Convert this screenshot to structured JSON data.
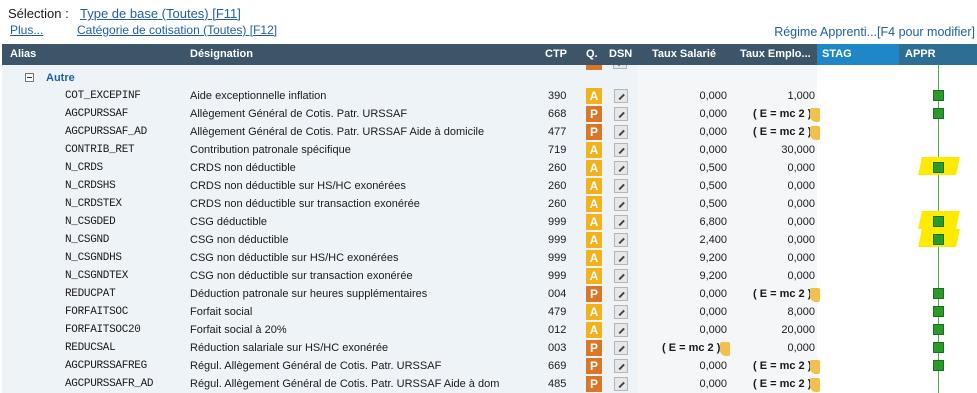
{
  "toolbar": {
    "selection_label": "Sélection :",
    "type_base_link": "Type de base (Toutes) [F11]",
    "plus_link": "Plus...",
    "categorie_link": "Catégorie de cotisation (Toutes) [F12]",
    "regime_text": "Régime Apprenti...[F4 pour modifier]"
  },
  "columns": {
    "alias": "Alias",
    "designation": "Désignation",
    "ctp": "CTP",
    "q": "Q.",
    "dsn": "DSN",
    "taux_salarie": "Taux Salarié",
    "taux_employeur": "Taux Emplo...",
    "stag": "STAG",
    "appr": "APPR"
  },
  "group": {
    "label": "Autre"
  },
  "rows": [
    {
      "alias": "COT_EXCEPINF",
      "designation": "Aide exceptionnelle inflation",
      "ctp": "390",
      "q": "A",
      "taux_salarie": "0,000",
      "taux_employeur": "1,000",
      "appr": true,
      "highlight": false
    },
    {
      "alias": "AGCPURSSAF",
      "designation": "Allègement Général de Cotis. Patr. URSSAF",
      "ctp": "668",
      "q": "P",
      "taux_salarie": "0,000",
      "taux_employeur": "( E = mc 2 )",
      "appr": true,
      "highlight": false
    },
    {
      "alias": "AGCPURSSAF_AD",
      "designation": "Allègement Général de Cotis. Patr. URSSAF Aide à domicile",
      "ctp": "477",
      "q": "P",
      "taux_salarie": "0,000",
      "taux_employeur": "( E = mc 2 )",
      "appr": false,
      "highlight": false
    },
    {
      "alias": "CONTRIB_RET",
      "designation": "Contribution patronale spécifique",
      "ctp": "719",
      "q": "A",
      "taux_salarie": "0,000",
      "taux_employeur": "30,000",
      "appr": false,
      "highlight": false
    },
    {
      "alias": "N_CRDS",
      "designation": "CRDS non déductible",
      "ctp": "260",
      "q": "A",
      "taux_salarie": "0,500",
      "taux_employeur": "0,000",
      "appr": true,
      "highlight": true
    },
    {
      "alias": "N_CRDSHS",
      "designation": "CRDS non déductible sur HS/HC exonérées",
      "ctp": "260",
      "q": "A",
      "taux_salarie": "0,500",
      "taux_employeur": "0,000",
      "appr": false,
      "highlight": false
    },
    {
      "alias": "N_CRDSTEX",
      "designation": "CRDS non déductible sur transaction exonérée",
      "ctp": "260",
      "q": "A",
      "taux_salarie": "0,500",
      "taux_employeur": "0,000",
      "appr": false,
      "highlight": false
    },
    {
      "alias": "N_CSGDED",
      "designation": "CSG déductible",
      "ctp": "999",
      "q": "A",
      "taux_salarie": "6,800",
      "taux_employeur": "0,000",
      "appr": true,
      "highlight": true
    },
    {
      "alias": "N_CSGND",
      "designation": "CSG non déductible",
      "ctp": "999",
      "q": "A",
      "taux_salarie": "2,400",
      "taux_employeur": "0,000",
      "appr": true,
      "highlight": true
    },
    {
      "alias": "N_CSGNDHS",
      "designation": "CSG non déductible sur HS/HC exonérées",
      "ctp": "999",
      "q": "A",
      "taux_salarie": "9,200",
      "taux_employeur": "0,000",
      "appr": false,
      "highlight": false
    },
    {
      "alias": "N_CSGNDTEX",
      "designation": "CSG non déductible sur transaction exonérée",
      "ctp": "999",
      "q": "A",
      "taux_salarie": "9,200",
      "taux_employeur": "0,000",
      "appr": false,
      "highlight": false
    },
    {
      "alias": "REDUCPAT",
      "designation": "Déduction patronale sur heures supplémentaires",
      "ctp": "004",
      "q": "P",
      "taux_salarie": "0,000",
      "taux_employeur": "( E = mc 2 )",
      "appr": true,
      "highlight": false
    },
    {
      "alias": "FORFAITSOC",
      "designation": "Forfait social",
      "ctp": "479",
      "q": "A",
      "taux_salarie": "0,000",
      "taux_employeur": "8,000",
      "appr": true,
      "highlight": false
    },
    {
      "alias": "FORFAITSOC20",
      "designation": "Forfait social à 20%",
      "ctp": "012",
      "q": "A",
      "taux_salarie": "0,000",
      "taux_employeur": "20,000",
      "appr": true,
      "highlight": false
    },
    {
      "alias": "REDUCSAL",
      "designation": "Réduction salariale sur HS/HC exonérée",
      "ctp": "003",
      "q": "P",
      "taux_salarie": "( E = mc 2 )",
      "taux_employeur": "0,000",
      "appr": true,
      "highlight": false
    },
    {
      "alias": "AGCPURSSAFREG",
      "designation": "Régul. Allègement Général de Cotis. Patr. URSSAF",
      "ctp": "669",
      "q": "P",
      "taux_salarie": "0,000",
      "taux_employeur": "( E = mc 2 )",
      "appr": true,
      "highlight": false
    },
    {
      "alias": "AGCPURSSAFR_AD",
      "designation": "Régul. Allègement Général de Cotis. Patr. URSSAF Aide à dom",
      "ctp": "485",
      "q": "P",
      "taux_salarie": "0,000",
      "taux_employeur": "( E = mc 2 )",
      "appr": false,
      "highlight": false
    }
  ],
  "colors": {
    "header_bg": "#3d5568",
    "stag_header": "#1f86c7",
    "appr_header": "#2f6e94",
    "badge_A": "#f2b21b",
    "badge_P": "#d97628",
    "check": "#2a9a2a",
    "highlight": "#ffeb00",
    "link": "#1f5fa8"
  }
}
